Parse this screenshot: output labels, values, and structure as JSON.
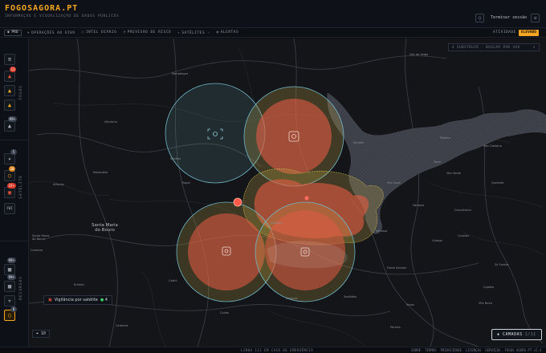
{
  "header": {
    "title": "FOGOSAGORA.PT",
    "subtitle": "INFORMAÇÃO E VISUALIZAÇÃO DE DADOS PÚBLICOS",
    "logout_label": "Terminar sessão",
    "user_icon": "user-icon",
    "menu_icon": "menu-icon"
  },
  "nav": {
    "pro_label": "PRO",
    "items": [
      {
        "label": "OPERAÇÕES AO VIVO",
        "icon": "broadcast-icon"
      },
      {
        "label": "INTEL DIÁRIO",
        "icon": "radar-icon"
      },
      {
        "label": "PREVISÃO DE RISCO",
        "icon": "forecast-icon"
      },
      {
        "label": "SATÉLITES",
        "icon": "satellite-icon"
      },
      {
        "label": "ALERTAS",
        "icon": "bell-icon"
      }
    ],
    "activity_label": "ATIVIDADE",
    "activity_level": "ELEVADO"
  },
  "sidebar": {
    "sections": [
      {
        "label": "FOGOS",
        "badges": [
          "13",
          "",
          "",
          "99+"
        ]
      },
      {
        "label": "SATÉLITE",
        "badges": [
          "5",
          "20",
          "37+",
          ""
        ]
      },
      {
        "label": "RECURSOS",
        "badges": [
          "99+",
          "99+",
          "0"
        ]
      }
    ],
    "list_icon": "list-icon",
    "fire_icon": "flame-icon",
    "satellite_icon": "satellite-icon",
    "radar_icon": "radar-icon",
    "camera_icon": "camera-icon",
    "truck_icon": "truck-icon",
    "plane_icon": "plane-icon",
    "expand_icon": "chevron-right-icon"
  },
  "map": {
    "search_placeholder": "4 SUBSTRUIR   ·   BUSCAR POR VOO",
    "surveillance_label": "Vigilância por satélite",
    "surveillance_count": "4",
    "zoom_level": "10",
    "layers_label": "CAMADAS",
    "layers_count": "1/11",
    "towns": [
      {
        "name": "Vila da Veiga",
        "big": false
      },
      {
        "name": "Montalegre",
        "big": false
      },
      {
        "name": "Vilarinho",
        "big": false
      },
      {
        "name": "Rebordelo",
        "big": false
      },
      {
        "name": "Alfarela",
        "big": false
      },
      {
        "name": "Sanfins",
        "big": false
      },
      {
        "name": "Trogal",
        "big": false
      },
      {
        "name": "Sendim",
        "big": false
      },
      {
        "name": "Ribeira",
        "big": false
      },
      {
        "name": "São Caetano",
        "big": false
      },
      {
        "name": "Torre",
        "big": false
      },
      {
        "name": "Vila Cova",
        "big": false
      },
      {
        "name": "Santa Maria\ndo Bouro",
        "big": true
      },
      {
        "name": "Santa Maria\ndo Bouro",
        "big": false
      },
      {
        "name": "Cerdeira",
        "big": false
      },
      {
        "name": "Valdosa",
        "big": false
      },
      {
        "name": "Carvalheira",
        "big": false
      },
      {
        "name": "Covelas",
        "big": false
      },
      {
        "name": "Ventosa",
        "big": false
      },
      {
        "name": "Soalhães",
        "big": false
      },
      {
        "name": "Ermida",
        "big": false
      },
      {
        "name": "Cabril",
        "big": false
      },
      {
        "name": "Cerdeira",
        "big": false
      },
      {
        "name": "Fonte Arcada",
        "big": false
      },
      {
        "name": "Seixo",
        "big": false
      },
      {
        "name": "Cepães",
        "big": false
      },
      {
        "name": "Vila Nova",
        "big": false
      },
      {
        "name": "Campo",
        "big": false
      },
      {
        "name": "Sá Fontes",
        "big": false
      },
      {
        "name": "Quintela",
        "big": false
      },
      {
        "name": "Vila Verde",
        "big": false
      },
      {
        "name": "Cerdeira",
        "big": false
      },
      {
        "name": "Ameixal",
        "big": false
      },
      {
        "name": "Covas",
        "big": false
      },
      {
        "name": "Pereira",
        "big": false
      }
    ],
    "colors": {
      "fire": "#e25a44",
      "buffer": "#c8b04a",
      "surveillance": "#6fb6c6",
      "water": "#3a3d45"
    }
  },
  "footer": {
    "emergency_label": "LINHA 112 EM CASO DE EMERGÊNCIA",
    "links": [
      "SOBRE",
      "TERMOS",
      "PRIVACIDADE",
      "LICENÇAS",
      "SERVIÇOS",
      "FOGOS AGORA PT v2.4"
    ]
  }
}
